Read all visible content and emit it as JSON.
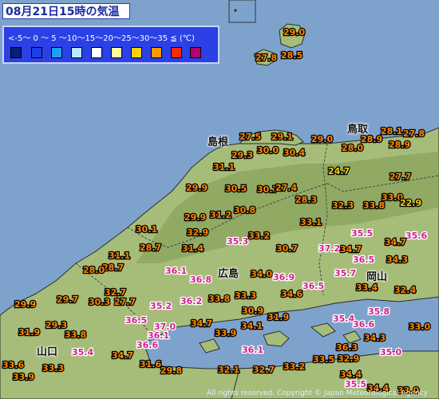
{
  "title": "08月21日15時の気温",
  "legend": {
    "scale_text": "<-5〜 0 〜 5 〜10〜15〜20〜25〜30〜35 ≦ (℃)",
    "colors": [
      "#0a1e78",
      "#1d40e8",
      "#1ea0f0",
      "#b8e8ff",
      "#ffffff",
      "#ffff99",
      "#ffd200",
      "#ff9900",
      "#ff2800",
      "#b4006e"
    ]
  },
  "colors": {
    "sea": "#7da3cc",
    "land_light": "#a6bd7a",
    "land_dark": "#7d9a52",
    "label_hot": "#ff8a00",
    "label_very_hot": "#d21e8c"
  },
  "prefectures": [
    {
      "id": "shimane",
      "name": "島根"
    },
    {
      "id": "tottori",
      "name": "鳥取"
    },
    {
      "id": "hiroshima",
      "name": "広島"
    },
    {
      "id": "okayama",
      "name": "岡山"
    },
    {
      "id": "yamaguchi",
      "name": "山口"
    }
  ],
  "temperatures": [
    {
      "v": "29.0",
      "level": "hot"
    },
    {
      "v": "27.8",
      "level": "hot"
    },
    {
      "v": "28.5",
      "level": "hot"
    },
    {
      "v": "27.5",
      "level": "hot"
    },
    {
      "v": "29.1",
      "level": "hot"
    },
    {
      "v": "29.0",
      "level": "hot"
    },
    {
      "v": "28.1",
      "level": "hot"
    },
    {
      "v": "27.8",
      "level": "hot"
    },
    {
      "v": "29.3",
      "level": "hot"
    },
    {
      "v": "30.0",
      "level": "hot"
    },
    {
      "v": "30.4",
      "level": "hot"
    },
    {
      "v": "28.0",
      "level": "hot"
    },
    {
      "v": "28.9",
      "level": "hot"
    },
    {
      "v": "28.9",
      "level": "hot"
    },
    {
      "v": "31.1",
      "level": "hot"
    },
    {
      "v": "24.7",
      "level": "mild"
    },
    {
      "v": "27.7",
      "level": "hot"
    },
    {
      "v": "29.9",
      "level": "hot"
    },
    {
      "v": "30.5",
      "level": "hot"
    },
    {
      "v": "30.7",
      "level": "hot"
    },
    {
      "v": "27.4",
      "level": "hot"
    },
    {
      "v": "28.3",
      "level": "hot"
    },
    {
      "v": "33.0",
      "level": "hot"
    },
    {
      "v": "22.9",
      "level": "mild"
    },
    {
      "v": "32.3",
      "level": "hot"
    },
    {
      "v": "33.8",
      "level": "hot"
    },
    {
      "v": "29.9",
      "level": "hot"
    },
    {
      "v": "31.2",
      "level": "hot"
    },
    {
      "v": "30.8",
      "level": "hot"
    },
    {
      "v": "33.1",
      "level": "hot"
    },
    {
      "v": "30.1",
      "level": "hot"
    },
    {
      "v": "32.9",
      "level": "hot"
    },
    {
      "v": "35.3",
      "level": "very_hot"
    },
    {
      "v": "33.2",
      "level": "hot"
    },
    {
      "v": "35.5",
      "level": "very_hot"
    },
    {
      "v": "35.6",
      "level": "very_hot"
    },
    {
      "v": "28.7",
      "level": "hot"
    },
    {
      "v": "31.4",
      "level": "hot"
    },
    {
      "v": "30.7",
      "level": "hot"
    },
    {
      "v": "37.2",
      "level": "very_hot"
    },
    {
      "v": "34.7",
      "level": "hot"
    },
    {
      "v": "34.7",
      "level": "hot"
    },
    {
      "v": "31.1",
      "level": "hot"
    },
    {
      "v": "28.7",
      "level": "hot"
    },
    {
      "v": "36.5",
      "level": "very_hot"
    },
    {
      "v": "34.3",
      "level": "hot"
    },
    {
      "v": "28.0",
      "level": "hot"
    },
    {
      "v": "36.1",
      "level": "very_hot"
    },
    {
      "v": "34.0",
      "level": "hot"
    },
    {
      "v": "36.9",
      "level": "very_hot"
    },
    {
      "v": "35.7",
      "level": "very_hot"
    },
    {
      "v": "36.8",
      "level": "very_hot"
    },
    {
      "v": "36.5",
      "level": "very_hot"
    },
    {
      "v": "32.7",
      "level": "hot"
    },
    {
      "v": "33.4",
      "level": "hot"
    },
    {
      "v": "32.4",
      "level": "hot"
    },
    {
      "v": "29.9",
      "level": "hot"
    },
    {
      "v": "29.7",
      "level": "hot"
    },
    {
      "v": "30.3",
      "level": "hot"
    },
    {
      "v": "27.7",
      "level": "hot"
    },
    {
      "v": "35.2",
      "level": "very_hot"
    },
    {
      "v": "36.2",
      "level": "very_hot"
    },
    {
      "v": "33.8",
      "level": "hot"
    },
    {
      "v": "33.3",
      "level": "hot"
    },
    {
      "v": "34.6",
      "level": "hot"
    },
    {
      "v": "35.8",
      "level": "very_hot"
    },
    {
      "v": "30.9",
      "level": "hot"
    },
    {
      "v": "31.9",
      "level": "hot"
    },
    {
      "v": "35.4",
      "level": "very_hot"
    },
    {
      "v": "29.3",
      "level": "hot"
    },
    {
      "v": "36.5",
      "level": "very_hot"
    },
    {
      "v": "37.0",
      "level": "very_hot"
    },
    {
      "v": "34.7",
      "level": "hot"
    },
    {
      "v": "34.1",
      "level": "hot"
    },
    {
      "v": "36.6",
      "level": "very_hot"
    },
    {
      "v": "33.0",
      "level": "hot"
    },
    {
      "v": "31.9",
      "level": "hot"
    },
    {
      "v": "33.8",
      "level": "hot"
    },
    {
      "v": "36.1",
      "level": "very_hot"
    },
    {
      "v": "33.9",
      "level": "hot"
    },
    {
      "v": "34.3",
      "level": "hot"
    },
    {
      "v": "36.6",
      "level": "very_hot"
    },
    {
      "v": "36.3",
      "level": "hot"
    },
    {
      "v": "35.4",
      "level": "very_hot"
    },
    {
      "v": "34.7",
      "level": "hot"
    },
    {
      "v": "36.1",
      "level": "very_hot"
    },
    {
      "v": "32.9",
      "level": "hot"
    },
    {
      "v": "35.0",
      "level": "very_hot"
    },
    {
      "v": "33.6",
      "level": "hot"
    },
    {
      "v": "33.3",
      "level": "hot"
    },
    {
      "v": "31.6",
      "level": "hot"
    },
    {
      "v": "33.5",
      "level": "hot"
    },
    {
      "v": "33.9",
      "level": "hot"
    },
    {
      "v": "29.8",
      "level": "hot"
    },
    {
      "v": "32.1",
      "level": "hot"
    },
    {
      "v": "32.7",
      "level": "hot"
    },
    {
      "v": "33.2",
      "level": "hot"
    },
    {
      "v": "34.4",
      "level": "hot"
    },
    {
      "v": "35.5",
      "level": "very_hot"
    },
    {
      "v": "34.4",
      "level": "hot"
    },
    {
      "v": "33.0",
      "level": "hot"
    }
  ],
  "footer": "All rights reserved. Copyright © Japan Meteorological Agency"
}
